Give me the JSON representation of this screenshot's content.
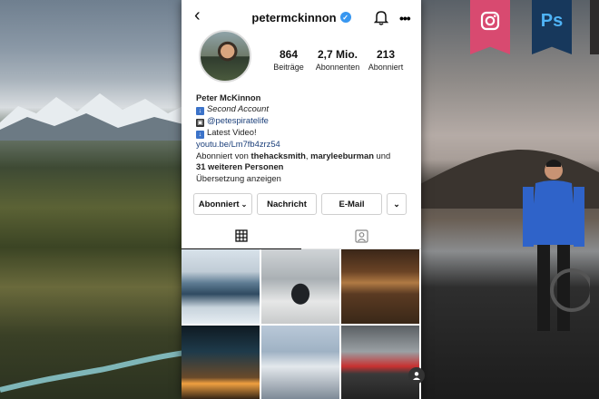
{
  "header": {
    "username": "petermckinnon",
    "verified_glyph": "✓"
  },
  "stats": [
    {
      "value": "864",
      "label": "Beiträge"
    },
    {
      "value": "2,7 Mio.",
      "label": "Abonnenten"
    },
    {
      "value": "213",
      "label": "Abonniert"
    }
  ],
  "bio": {
    "name": "Peter McKinnon",
    "line1": "Second Account",
    "line2": "@petespiratelife",
    "line3": "Latest Video!",
    "link": "youtu.be/Lm7fb4zrz54",
    "followed_prefix": "Abonniert von ",
    "followed_user1": "thehacksmith",
    "followed_sep": ", ",
    "followed_user2": "maryleeburman",
    "followed_and": " und",
    "followed_others": "31 weiteren Personen",
    "translate": "Übersetzung anzeigen"
  },
  "buttons": {
    "subscribed": "Abonniert",
    "message": "Nachricht",
    "email": "E-Mail"
  },
  "badges": {
    "ps": "Ps"
  },
  "colors": {
    "verified": "#3897f0",
    "link": "#1b3f7a",
    "instagram_badge": "#d84a70",
    "photoshop_badge": "#17385c"
  }
}
